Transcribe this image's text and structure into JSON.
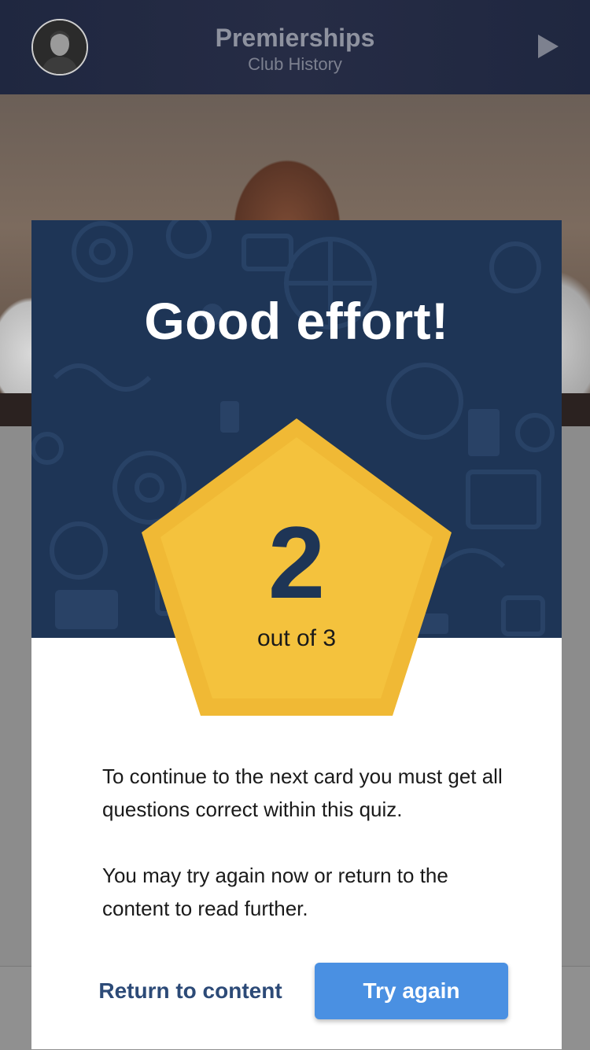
{
  "header": {
    "title": "Premierships",
    "subtitle": "Club History",
    "avatar_icon": "profile-avatar",
    "play_icon": "play-icon"
  },
  "modal": {
    "title": "Good effort!",
    "score": "2",
    "score_total": "out of 3",
    "message_1": "To continue to the next card you must get all questions correct within this quiz.",
    "message_2": "You may try again now or return to the content to read further.",
    "return_label": "Return to content",
    "try_again_label": "Try again"
  },
  "colors": {
    "header_bg": "#222a43",
    "modal_top_bg": "#1e3556",
    "badge": "#f0b935",
    "badge_inner": "#f4c23d",
    "primary_button": "#4a90e2",
    "link": "#2c4a77"
  }
}
